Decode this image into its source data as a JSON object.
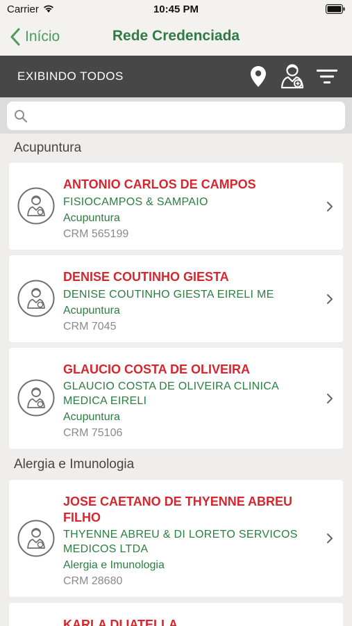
{
  "status_bar": {
    "carrier": "Carrier",
    "time": "10:45 PM"
  },
  "nav": {
    "back_label": "Início",
    "title": "Rede Credenciada"
  },
  "toolbar": {
    "label": "EXIBINDO TODOS"
  },
  "search": {
    "value": "",
    "placeholder": ""
  },
  "colors": {
    "accent_green": "#2b7d40",
    "name_red": "#d6262e",
    "toolbar_bg": "#474747"
  },
  "sections": [
    {
      "title": "Acupuntura",
      "items": [
        {
          "name": "ANTONIO CARLOS DE CAMPOS",
          "company": "FISIOCAMPOS & SAMPAIO",
          "specialty": "Acupuntura",
          "crm": "CRM 565199"
        },
        {
          "name": "DENISE COUTINHO GIESTA",
          "company": "DENISE COUTINHO GIESTA EIRELI ME",
          "specialty": "Acupuntura",
          "crm": "CRM 7045"
        },
        {
          "name": "GLAUCIO COSTA DE OLIVEIRA",
          "company": "GLAUCIO COSTA DE OLIVEIRA CLINICA MEDICA EIRELI",
          "specialty": "Acupuntura",
          "crm": "CRM 75106"
        }
      ]
    },
    {
      "title": "Alergia e Imunologia",
      "items": [
        {
          "name": "JOSE CAETANO DE THYENNE ABREU FILHO",
          "company": "THYENNE ABREU & DI LORETO SERVICOS MEDICOS LTDA",
          "specialty": "Alergia e Imunologia",
          "crm": "CRM 28680"
        },
        {
          "name": "KARLA DI IATELLA"
        }
      ]
    }
  ]
}
